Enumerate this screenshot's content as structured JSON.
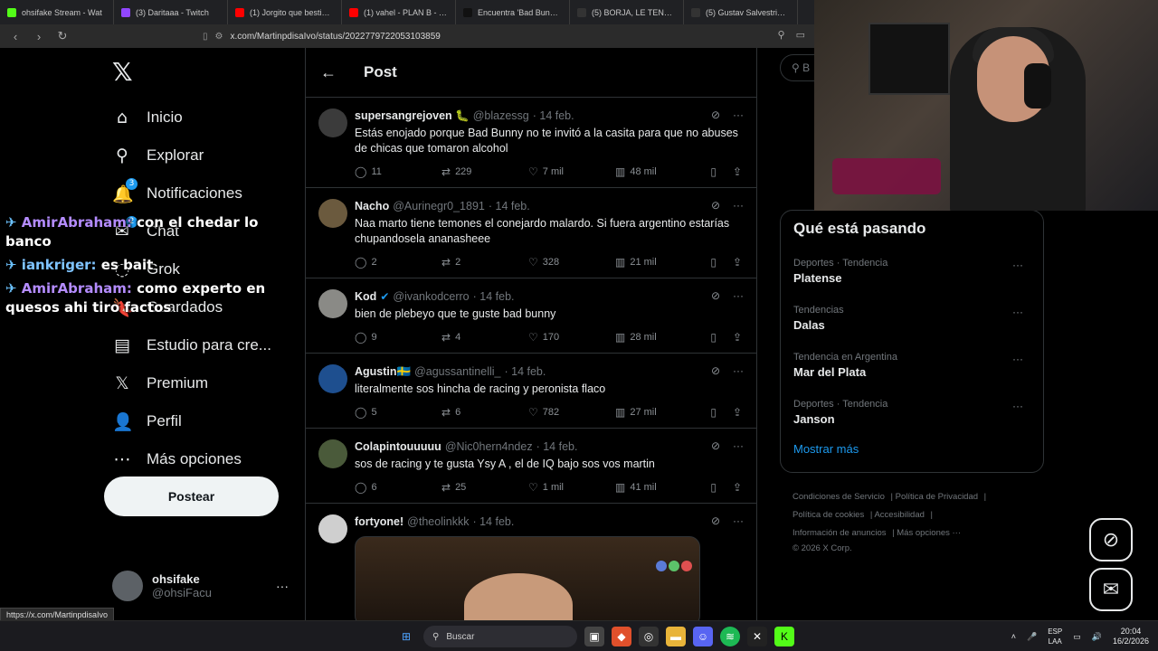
{
  "browser": {
    "tabs": [
      {
        "title": "ohsifake Stream - Wat",
        "color": "#53fc18"
      },
      {
        "title": "(3) Daritaaa - Twitch",
        "color": "#9146ff"
      },
      {
        "title": "(1) Jorgito que bestia' - Yo",
        "color": "#ff0000"
      },
      {
        "title": "(1) vahel - PLAN B - YouTu",
        "color": "#ff0000"
      },
      {
        "title": "Encuentra 'Bad Bunny Llev",
        "color": "#111111"
      },
      {
        "title": "(5) BORJA, LE TENES QUE",
        "color": "#333333"
      },
      {
        "title": "(5) Gustav Salvestrini (@g",
        "color": "#333333"
      }
    ],
    "url": "x.com/MartinpdisaIvo/status/2022779722053103859",
    "status_url": "https://x.com/MartinpdisaIvo"
  },
  "sidebar": {
    "logo": "𝕏",
    "nav": [
      {
        "label": "Inicio",
        "icon": "⌂",
        "name": "home"
      },
      {
        "label": "Explorar",
        "icon": "⚲",
        "name": "explore"
      },
      {
        "label": "Notificaciones",
        "icon": "🔔",
        "name": "notifications",
        "badge": "3"
      },
      {
        "label": "Chat",
        "icon": "✉",
        "name": "chat",
        "badge": "2"
      },
      {
        "label": "Grok",
        "icon": "◌",
        "name": "grok"
      },
      {
        "label": "Guardados",
        "icon": "🔖",
        "name": "bookmarks"
      },
      {
        "label": "Estudio para cre...",
        "icon": "▤",
        "name": "creator-studio"
      },
      {
        "label": "Premium",
        "icon": "𝕏",
        "name": "premium"
      },
      {
        "label": "Perfil",
        "icon": "👤",
        "name": "profile"
      },
      {
        "label": "Más opciones",
        "icon": "⋯",
        "name": "more-options"
      }
    ],
    "post_button": "Postear",
    "account": {
      "name": "ohsifake",
      "handle": "@ohsiFacu"
    }
  },
  "chat_overlay": [
    {
      "user": "AmirAbraham:",
      "message": "con el chedar lo banco"
    },
    {
      "user": "iankriger:",
      "message": "es bait"
    },
    {
      "user": "AmirAbraham:",
      "message": "como experto en quesos ahi tiro factos"
    }
  ],
  "main": {
    "title": "Post",
    "tweets": [
      {
        "name": "supersangrejoven 🐛",
        "handle": "@blazessg",
        "date": "· 14 feb.",
        "text": "Estás enojado porque Bad Bunny no te invitó a la casita para que no abuses de chicas que tomaron alcohol",
        "replies": "11",
        "reposts": "229",
        "likes": "7 mil",
        "views": "48 mil",
        "avatar": "#3b3b3b"
      },
      {
        "name": "Nacho",
        "handle": "@Aurinegr0_1891",
        "date": "· 14 feb.",
        "text": "Naa marto tiene temones el conejardo malardo. Si fuera argentino estarías chupandosela ananasheee",
        "replies": "2",
        "reposts": "2",
        "likes": "328",
        "views": "21 mil",
        "avatar": "#6b5a3e"
      },
      {
        "name": "Kod",
        "handle": "@ivankodcerro",
        "date": "· 14 feb.",
        "text": "bien de plebeyo que te guste bad bunny",
        "replies": "9",
        "reposts": "4",
        "likes": "170",
        "views": "28 mil",
        "avatar": "#8a8a86",
        "verified": "✔"
      },
      {
        "name": "Agustin🇸🇪",
        "handle": "@agussantinelli_",
        "date": "· 14 feb.",
        "text": "literalmente sos hincha de racing y peronista flaco",
        "replies": "5",
        "reposts": "6",
        "likes": "782",
        "views": "27 mil",
        "avatar": "#1e4f8f"
      },
      {
        "name": "Colapintouuuuu",
        "handle": "@Nic0hern4ndez",
        "date": "· 14 feb.",
        "text": "sos de racing y te gusta Ysy A , el de IQ bajo sos vos martin",
        "replies": "6",
        "reposts": "25",
        "likes": "1 mil",
        "views": "41 mil",
        "avatar": "#4a5a3a"
      },
      {
        "name": "fortyone!",
        "handle": "@theolinkkk",
        "date": "· 14 feb.",
        "text": "",
        "avatar": "#cfcfcf"
      }
    ]
  },
  "right": {
    "search_placeholder": "B",
    "trends_title": "Qué está pasando",
    "trends": [
      {
        "category": "Deportes · Tendencia",
        "name": "Platense"
      },
      {
        "category": "Tendencias",
        "name": "Dalas"
      },
      {
        "category": "Tendencia en Argentina",
        "name": "Mar del Plata"
      },
      {
        "category": "Deportes · Tendencia",
        "name": "Janson"
      }
    ],
    "show_more": "Mostrar más",
    "footer": {
      "terms": "Condiciones de Servicio",
      "privacy": "Política de Privacidad",
      "cookies": "Política de cookies",
      "accessibility": "Accesibilidad",
      "ads": "Información de anuncios",
      "more": "Más opciones ···",
      "copyright": "© 2026 X Corp."
    }
  },
  "taskbar": {
    "search": "Buscar",
    "lang_top": "ESP",
    "lang_bottom": "LAA",
    "time": "20:04",
    "date": "16/2/2026"
  }
}
